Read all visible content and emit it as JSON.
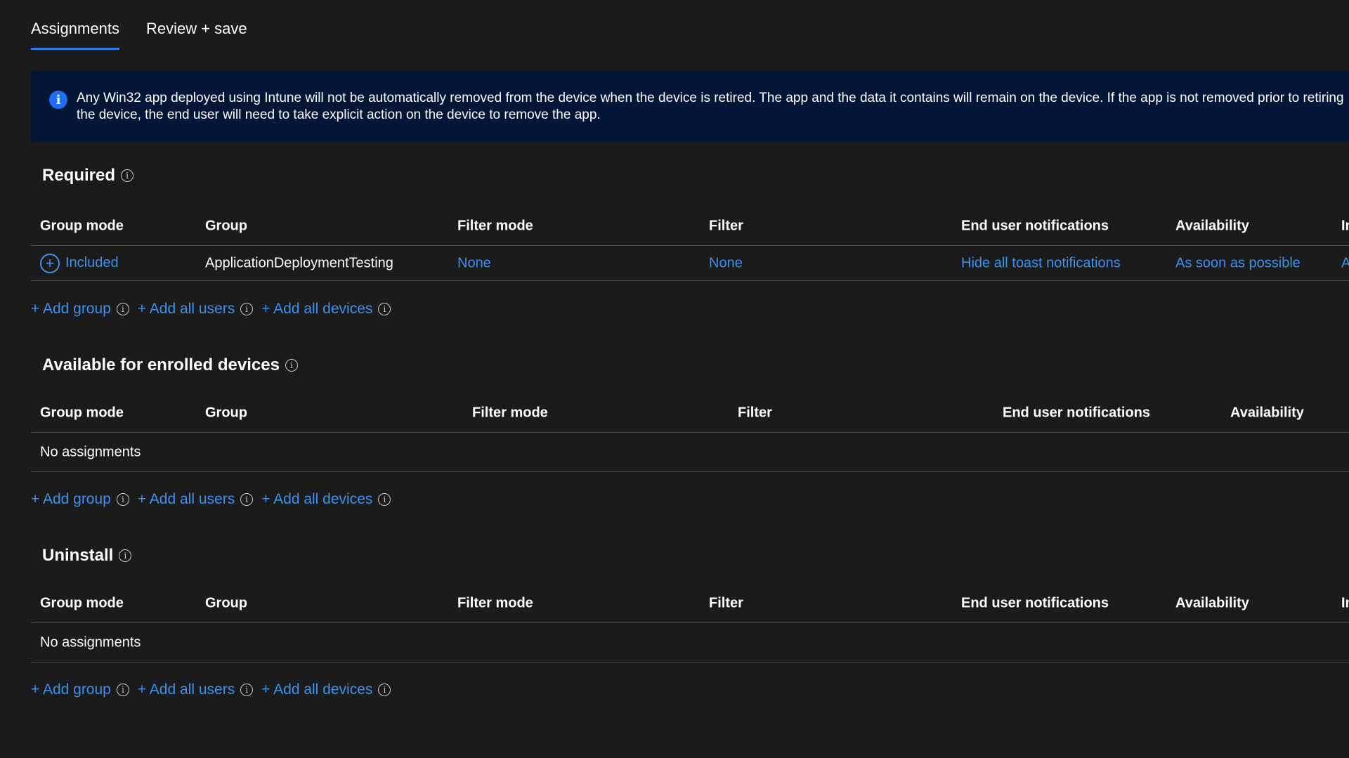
{
  "tabs": [
    {
      "label": "Assignments",
      "active": true
    },
    {
      "label": "Review + save",
      "active": false
    }
  ],
  "banner": {
    "icon": "info-icon",
    "text": "Any Win32 app deployed using Intune will not be automatically removed from the device when the device is retired. The app and the data it contains will remain on the device. If the app is not removed prior to retiring the device, the end user will need to take explicit action on the device to remove the app."
  },
  "columns": {
    "group_mode": "Group mode",
    "group": "Group",
    "filter_mode": "Filter mode",
    "filter": "Filter",
    "notifications": "End user notifications",
    "availability": "Availability",
    "installation": "Installation deadline"
  },
  "required": {
    "title": "Required",
    "row": {
      "group_mode": "Included",
      "group": "ApplicationDeploymentTesting",
      "filter_mode": "None",
      "filter": "None",
      "notifications": "Hide all toast notifications",
      "availability": "As soon as possible",
      "installation": "As soon as possible"
    }
  },
  "available": {
    "title": "Available for enrolled devices",
    "empty": "No assignments"
  },
  "uninstall": {
    "title": "Uninstall",
    "empty": "No assignments"
  },
  "actions": {
    "add_group": "+ Add group",
    "add_all_users": "+ Add all users",
    "add_all_devices": "+ Add all devices"
  },
  "colors": {
    "background": "#1b1b1b",
    "banner": "#041638",
    "link": "#3b91f0",
    "tab_underline": "#2d7de2"
  }
}
